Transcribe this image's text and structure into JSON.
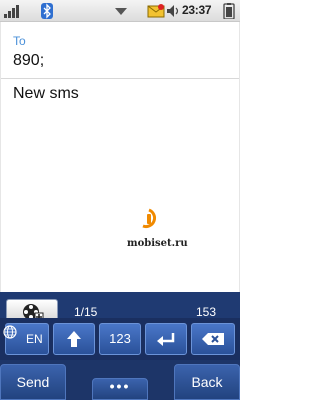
{
  "status_bar": {
    "time": "23:37",
    "icons": [
      "signal-icon",
      "bluetooth-icon",
      "dropdown-arrow-icon",
      "new-message-icon",
      "speaker-icon",
      "battery-icon"
    ]
  },
  "compose": {
    "to_label": "To",
    "to_value": "890;",
    "message": "New sms",
    "watermark_text": "mobiset.ru"
  },
  "toolbar": {
    "page_counter": "1/15",
    "char_counter": "153",
    "input_mode": "abc"
  },
  "keyboard": {
    "lang_label": "EN",
    "numeric_label": "123"
  },
  "softkeys": {
    "left": "Send",
    "center": "•••",
    "right": "Back"
  },
  "colors": {
    "toolbar_bg": "#1f3a72",
    "key_blue": "#3a66b8",
    "to_label": "#4a90d9"
  }
}
